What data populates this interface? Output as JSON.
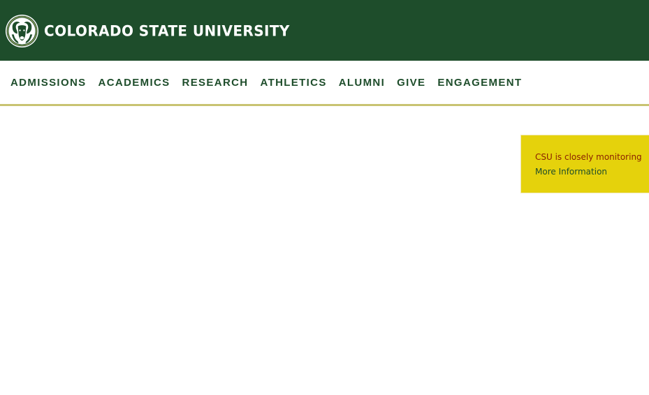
{
  "header": {
    "logo_icon": "csu-ram-logo-icon",
    "title": "COLORADO STATE UNIVERSITY",
    "brand_color": "#1e4d2b",
    "accent_color": "#c8c372"
  },
  "nav": {
    "items": [
      {
        "label": "ADMISSIONS"
      },
      {
        "label": "ACADEMICS"
      },
      {
        "label": "RESEARCH"
      },
      {
        "label": "ATHLETICS"
      },
      {
        "label": "ALUMNI"
      },
      {
        "label": "GIVE"
      },
      {
        "label": "ENGAGEMENT"
      }
    ]
  },
  "alert": {
    "message": "CSU is closely monitoring",
    "link_label": "More Information",
    "background_color": "#e5d20c"
  }
}
